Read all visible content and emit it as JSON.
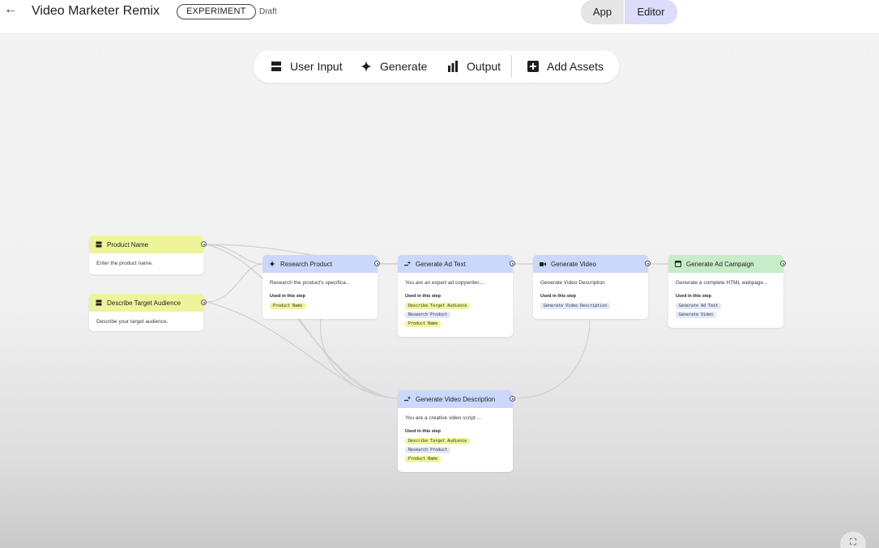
{
  "header": {
    "back_icon": "arrow-left-icon",
    "title": "Video Marketer Remix",
    "badge": "EXPERIMENT",
    "status": "Draft",
    "modes": {
      "app": "App",
      "editor": "Editor"
    },
    "active_mode": "Editor"
  },
  "toolbar": {
    "user_input": "User Input",
    "generate": "Generate",
    "output": "Output",
    "add_assets": "Add Assets"
  },
  "colors": {
    "input_node": "#eef49a",
    "generate_node": "#c9d8fb",
    "output_node": "#c6ecc8",
    "editor_mode": "#dcdcfb"
  },
  "nodes": {
    "product_name": {
      "title": "Product Name",
      "desc": "Enter the product name."
    },
    "target_audience": {
      "title": "Describe Target Audience",
      "desc": "Describe your target audience."
    },
    "research_product": {
      "title": "Research Product",
      "desc": "Research the product's specifica...",
      "used_label": "Used in this step",
      "chips": [
        "Product Name"
      ]
    },
    "generate_ad_text": {
      "title": "Generate Ad Text",
      "desc": "You are an expert ad copywriter,...",
      "used_label": "Used in this step",
      "chips": [
        "Describe Target Audience",
        "Research Product",
        "Product Name"
      ]
    },
    "generate_video": {
      "title": "Generate Video",
      "desc": "Generate Video Description",
      "used_label": "Used in this step",
      "chips": [
        "Generate Video Description"
      ]
    },
    "generate_ad_campaign": {
      "title": "Generate Ad Campaign",
      "desc": "Generate a complete HTML webpage...",
      "used_label": "Used in this step",
      "chips": [
        "Generate Ad Text",
        "Generate Video"
      ]
    },
    "generate_video_description": {
      "title": "Generate Video Description",
      "desc": "You are a creative video script ...",
      "used_label": "Used in this step",
      "chips": [
        "Describe Target Audience",
        "Research Product",
        "Product Name"
      ]
    }
  },
  "fit_icon": "fit-view-icon"
}
